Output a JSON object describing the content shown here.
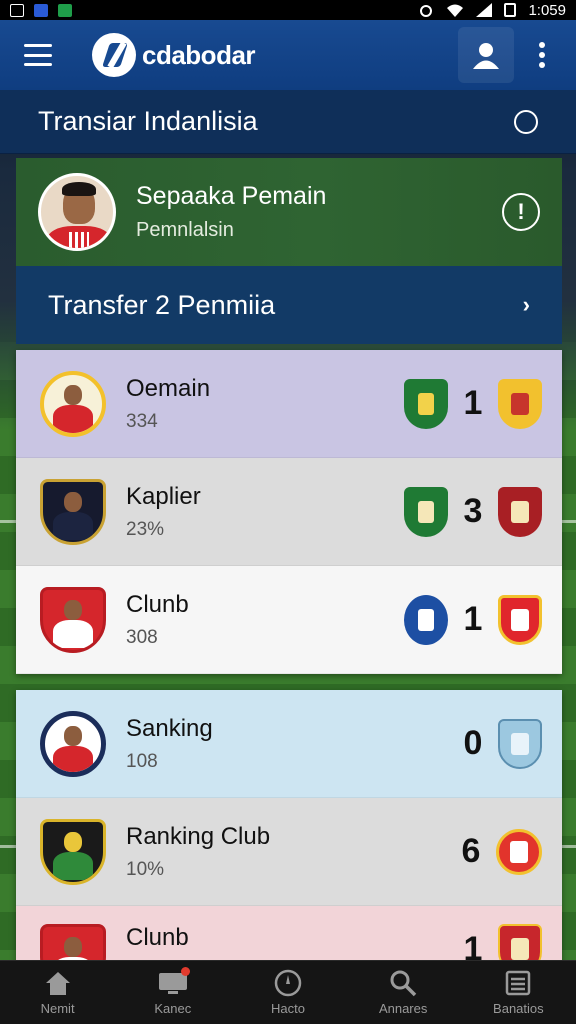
{
  "statusbar": {
    "time": "1:059"
  },
  "appbar": {
    "logo_text": "cdabodar"
  },
  "subheader": {
    "title": "Transiar Indanlisia"
  },
  "featured": {
    "name": "Sepaaka Pemain",
    "subtitle": "Pemnlalsin",
    "info_glyph": "!"
  },
  "transfer": {
    "label": "Transfer 2 Penmiia",
    "chevron": "›"
  },
  "rows": [
    {
      "name": "Oemain",
      "value": "334",
      "score": "1"
    },
    {
      "name": "Kaplier",
      "value": "23%",
      "score": "3"
    },
    {
      "name": "Clunb",
      "value": "308",
      "score": "1"
    },
    {
      "name": "Sanking",
      "value": "108",
      "score": "0"
    },
    {
      "name": "Ranking Club",
      "value": "10%",
      "score": "6"
    },
    {
      "name": "Clunb",
      "value": "",
      "score": "1"
    }
  ],
  "bottomnav": [
    {
      "label": "Nemit",
      "icon": "home-icon"
    },
    {
      "label": "Kanec",
      "icon": "tv-icon"
    },
    {
      "label": "Hacto",
      "icon": "compass-icon"
    },
    {
      "label": "Annares",
      "icon": "search-icon"
    },
    {
      "label": "Banatios",
      "icon": "list-icon"
    }
  ],
  "colors": {
    "appbar": "#184a91",
    "subheader": "#0f2f59",
    "featured": "#2f6432",
    "transfer": "#123a66",
    "row_purple": "#c9c5e3",
    "row_grey": "#dcdcdc",
    "row_white": "#f6f6f6",
    "row_blue": "#cde5f2",
    "row_pink": "#f2d4d8"
  }
}
